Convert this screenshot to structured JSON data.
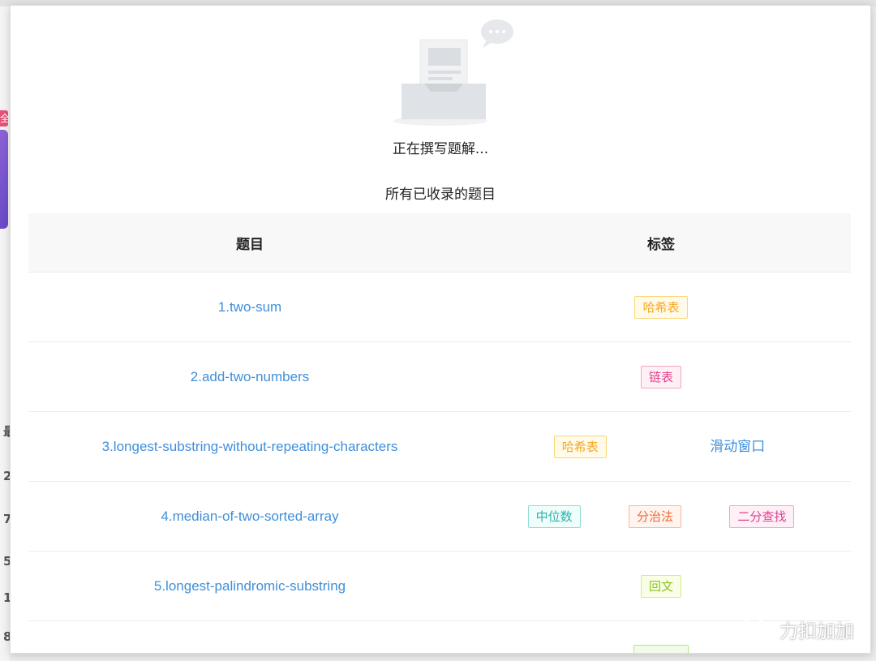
{
  "background": {
    "badge_char": "全",
    "side_glyphs": [
      "最",
      "2",
      "7",
      "5",
      "1",
      "8"
    ]
  },
  "popup": {
    "status_text": "正在撰写题解...",
    "list_title": "所有已收录的题目",
    "table": {
      "headers": [
        "题目",
        "标签"
      ],
      "rows": [
        {
          "problem": "1.two-sum",
          "tags": [
            {
              "label": "哈希表",
              "color": "#f5a623",
              "bg": "#fffbe8",
              "border": "#f9d67a"
            }
          ]
        },
        {
          "problem": "2.add-two-numbers",
          "tags": [
            {
              "label": "链表",
              "color": "#e0458a",
              "bg": "#fff0f6",
              "border": "#f3a6c8"
            }
          ]
        },
        {
          "problem": "3.longest-substring-without-repeating-characters",
          "tags": [
            {
              "label": "哈希表",
              "color": "#f5a623",
              "bg": "#fffbe8",
              "border": "#f9d67a"
            },
            {
              "label": "滑动窗口",
              "color": "#3f8fdb",
              "plain": true
            }
          ]
        },
        {
          "problem": "4.median-of-two-sorted-array",
          "tags": [
            {
              "label": "中位数",
              "color": "#2bb3a8",
              "bg": "#effdfb",
              "border": "#8fdcd3"
            },
            {
              "label": "分治法",
              "color": "#f0693b",
              "bg": "#fff4ee",
              "border": "#f8b99f"
            },
            {
              "label": "二分查找",
              "color": "#d9458f",
              "bg": "#fff0f7",
              "border": "#efa6cb"
            }
          ]
        },
        {
          "problem": "5.longest-palindromic-substring",
          "tags": [
            {
              "label": "回文",
              "color": "#8dc21f",
              "bg": "#f8ffe6",
              "border": "#d1ec8c"
            }
          ]
        },
        {
          "problem": "",
          "tags": [
            {
              "label": "",
              "color": "#5fb832",
              "bg": "#f2fbe9",
              "border": "#b5e08f"
            }
          ]
        }
      ]
    }
  },
  "watermark": {
    "text": "力扣加加",
    "icon": "wechat-icon"
  }
}
